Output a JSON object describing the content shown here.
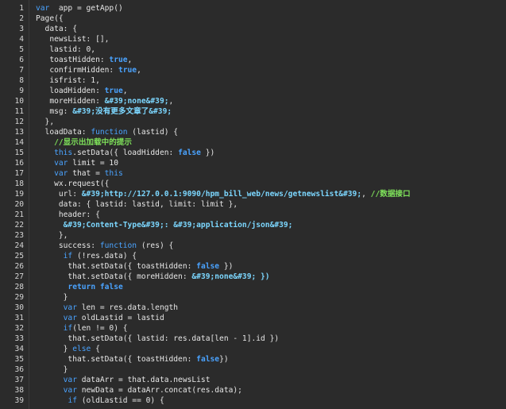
{
  "editor": {
    "lines": [
      [
        [
          "kw",
          "var"
        ],
        [
          "",
          "  app = getApp()"
        ]
      ],
      [
        [
          "",
          "Page({"
        ]
      ],
      [
        [
          "",
          "  data: {"
        ]
      ],
      [
        [
          "",
          "   newsList: [],"
        ]
      ],
      [
        [
          "",
          "   lastid: 0,"
        ]
      ],
      [
        [
          "",
          "   toastHidden: "
        ],
        [
          "bool",
          "true"
        ],
        [
          "",
          ","
        ]
      ],
      [
        [
          "",
          "   confirmHidden: "
        ],
        [
          "bool",
          "true"
        ],
        [
          "",
          ","
        ]
      ],
      [
        [
          "",
          "   isfrist: 1,"
        ]
      ],
      [
        [
          "",
          "   loadHidden: "
        ],
        [
          "bool",
          "true"
        ],
        [
          "",
          ","
        ]
      ],
      [
        [
          "",
          "   moreHidden: "
        ],
        [
          "str",
          "&#39;none&#39;"
        ],
        [
          "",
          ","
        ]
      ],
      [
        [
          "",
          "   msg: "
        ],
        [
          "str",
          "&#39;没有更多文章了&#39;"
        ]
      ],
      [
        [
          "",
          "  },"
        ]
      ],
      [
        [
          "",
          "  loadData: "
        ],
        [
          "kw",
          "function"
        ],
        [
          "",
          " (lastid) {"
        ]
      ],
      [
        [
          "cm",
          "    //显示出加载中的提示"
        ]
      ],
      [
        [
          "",
          "    "
        ],
        [
          "kw",
          "this"
        ],
        [
          "",
          ".setData({ loadHidden: "
        ],
        [
          "bool",
          "false"
        ],
        [
          "",
          " })"
        ]
      ],
      [
        [
          "",
          "    "
        ],
        [
          "kw",
          "var"
        ],
        [
          "",
          " limit = 10"
        ]
      ],
      [
        [
          "",
          "    "
        ],
        [
          "kw",
          "var"
        ],
        [
          "",
          " that = "
        ],
        [
          "kw",
          "this"
        ]
      ],
      [
        [
          "",
          "    wx.request({"
        ]
      ],
      [
        [
          "",
          "     url: "
        ],
        [
          "str",
          "&#39;http://127.0.0.1:9090/hpm_bill_web/news/getnewslist&#39;"
        ],
        [
          "",
          ", "
        ],
        [
          "cm",
          "//数据接口"
        ]
      ],
      [
        [
          "",
          "     data: { lastid: lastid, limit: limit },"
        ]
      ],
      [
        [
          "",
          "     header: {"
        ]
      ],
      [
        [
          "",
          "      "
        ],
        [
          "str",
          "&#39;Content-Type&#39;: &#39;application/json&#39;"
        ]
      ],
      [
        [
          "",
          "     },"
        ]
      ],
      [
        [
          "",
          "     success: "
        ],
        [
          "kw",
          "function"
        ],
        [
          "",
          " (res) {"
        ]
      ],
      [
        [
          "",
          "      "
        ],
        [
          "kw",
          "if"
        ],
        [
          "",
          " (!res.data) {"
        ]
      ],
      [
        [
          "",
          "       that.setData({ toastHidden: "
        ],
        [
          "bool",
          "false"
        ],
        [
          "",
          " })"
        ]
      ],
      [
        [
          "",
          "       that.setData({ moreHidden: "
        ],
        [
          "str",
          "&#39;none&#39; })"
        ]
      ],
      [
        [
          "",
          "       "
        ],
        [
          "bool",
          "return false"
        ]
      ],
      [
        [
          "",
          "      }"
        ]
      ],
      [
        [
          "",
          "      "
        ],
        [
          "kw",
          "var"
        ],
        [
          "",
          " len = res.data.length"
        ]
      ],
      [
        [
          "",
          "      "
        ],
        [
          "kw",
          "var"
        ],
        [
          "",
          " oldLastid = lastid"
        ]
      ],
      [
        [
          "",
          "      "
        ],
        [
          "kw",
          "if"
        ],
        [
          "",
          "(len != 0) {"
        ]
      ],
      [
        [
          "",
          "       that.setData({ lastid: res.data[len - 1].id })"
        ]
      ],
      [
        [
          "",
          "      } "
        ],
        [
          "kw",
          "else"
        ],
        [
          "",
          " {"
        ]
      ],
      [
        [
          "",
          "       that.setData({ toastHidden: "
        ],
        [
          "bool",
          "false"
        ],
        [
          "",
          "})"
        ]
      ],
      [
        [
          "",
          "      }"
        ]
      ],
      [
        [
          "",
          "      "
        ],
        [
          "kw",
          "var"
        ],
        [
          "",
          " dataArr = that.data.newsList"
        ]
      ],
      [
        [
          "",
          "      "
        ],
        [
          "kw",
          "var"
        ],
        [
          "",
          " newData = dataArr.concat(res.data);"
        ]
      ],
      [
        [
          "",
          "       "
        ],
        [
          "kw",
          "if"
        ],
        [
          "",
          " (oldLastid == 0) {"
        ]
      ]
    ]
  }
}
